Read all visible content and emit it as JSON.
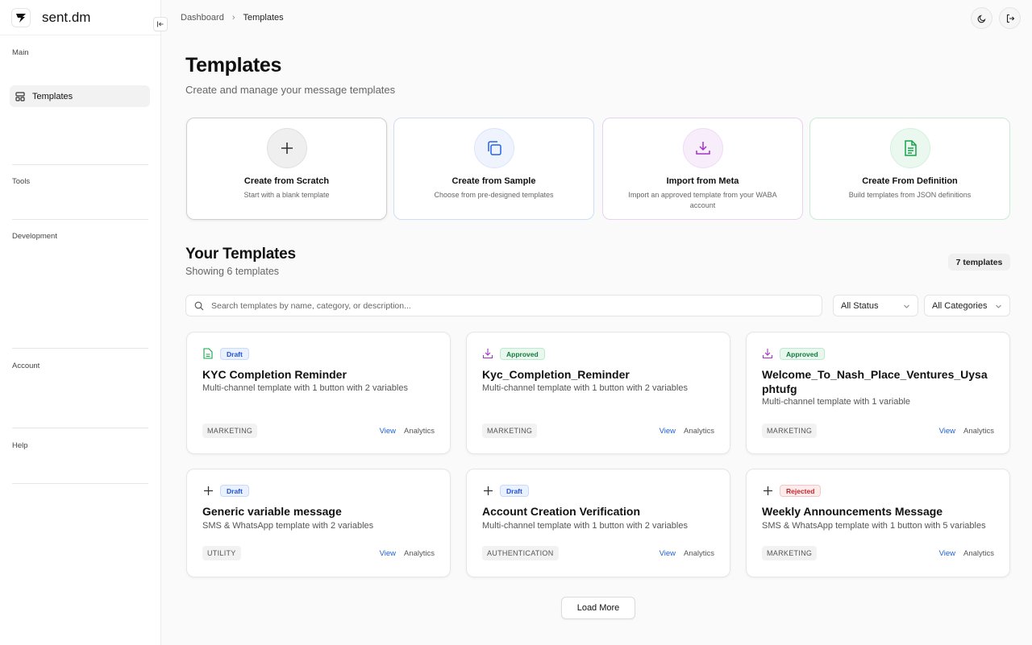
{
  "app": {
    "name": "sent.dm",
    "logo_icon": "sent-logo-icon"
  },
  "sidebar": {
    "sections": [
      {
        "label": "Main",
        "items": [
          {
            "label": "Templates",
            "icon": "layout-icon",
            "active": true
          }
        ]
      },
      {
        "label": "Tools",
        "items": []
      },
      {
        "label": "Development",
        "items": []
      },
      {
        "label": "Account",
        "items": []
      },
      {
        "label": "Help",
        "items": []
      }
    ]
  },
  "breadcrumb": [
    "Dashboard",
    "Templates"
  ],
  "header": {
    "title": "Templates",
    "subtitle": "Create and manage your message templates"
  },
  "create_options": [
    {
      "title": "Create from Scratch",
      "subtitle": "Start with a blank template",
      "icon": "plus-icon",
      "accent": "#555555"
    },
    {
      "title": "Create from Sample",
      "subtitle": "Choose from pre-designed templates",
      "icon": "copy-icon",
      "accent": "#2563eb"
    },
    {
      "title": "Import from Meta",
      "subtitle": "Import an approved template from your WABA account",
      "icon": "download-icon",
      "accent": "#a333c8"
    },
    {
      "title": "Create From Definition",
      "subtitle": "Build templates from JSON definitions",
      "icon": "file-text-icon",
      "accent": "#16a34a"
    }
  ],
  "your_templates": {
    "title": "Your Templates",
    "subtitle": "Showing 6 templates",
    "count_badge": "7 templates",
    "search_placeholder": "Search templates by name, category, or description...",
    "status_filter": "All Status",
    "category_filter": "All Categories"
  },
  "templates": [
    {
      "name": "KYC Completion Reminder",
      "description": "Multi-channel template with 1 button with 2 variables",
      "status": "Draft",
      "category": "MARKETING",
      "icon": "file-text-icon",
      "view": "View",
      "analytics": "Analytics"
    },
    {
      "name": "Kyc_Completion_Reminder",
      "description": "Multi-channel template with 1 button with 2 variables",
      "status": "Approved",
      "category": "MARKETING",
      "icon": "download-icon",
      "view": "View",
      "analytics": "Analytics"
    },
    {
      "name": "Welcome_To_Nash_Place_Ventures_Uysaphtufg",
      "description": "Multi-channel template with 1 variable",
      "status": "Approved",
      "category": "MARKETING",
      "icon": "download-icon",
      "view": "View",
      "analytics": "Analytics"
    },
    {
      "name": "Generic variable message",
      "description": "SMS & WhatsApp template with 2 variables",
      "status": "Draft",
      "category": "UTILITY",
      "icon": "plus-icon",
      "view": "View",
      "analytics": "Analytics"
    },
    {
      "name": "Account Creation Verification",
      "description": "Multi-channel template with 1 button with 2 variables",
      "status": "Draft",
      "category": "AUTHENTICATION",
      "icon": "plus-icon",
      "view": "View",
      "analytics": "Analytics"
    },
    {
      "name": "Weekly Announcements Message",
      "description": "SMS & WhatsApp template with 1 button with 5 variables",
      "status": "Rejected",
      "category": "MARKETING",
      "icon": "plus-icon",
      "view": "View",
      "analytics": "Analytics"
    }
  ],
  "load_more": "Load More",
  "colors": {
    "draft": "#1d4fd7",
    "approved": "#137a3c",
    "rejected": "#c0262d",
    "link": "#1d5fd7"
  }
}
